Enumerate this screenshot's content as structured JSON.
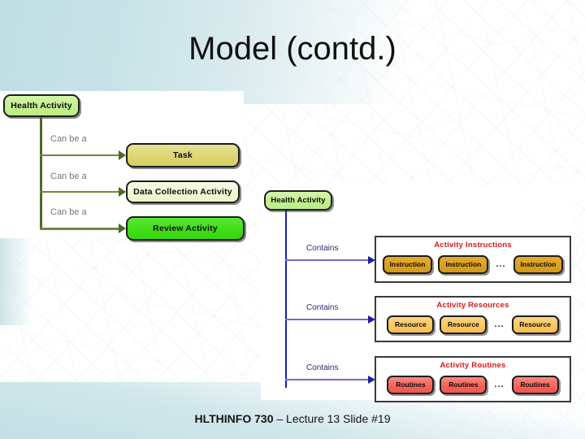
{
  "slide": {
    "title": "Model (contd.)",
    "footer_code": "HLTHINFO 730",
    "footer_rest": " – Lecture 13 Slide #19",
    "colors": {
      "background_tint": "#c3e0e5",
      "health_activity": "#c2ef8e",
      "task": "#dcd671",
      "data_collection_activity": "#eff7d2",
      "review_activity": "#3fdf16",
      "instruction": "#dca121",
      "resource": "#fbc85e",
      "routines": "#f4645c",
      "group_title": "#e01515",
      "left_connector": "#4d6b23",
      "right_connector": "#1e1ea8"
    }
  },
  "left_diagram": {
    "root": {
      "label": "Health Activity"
    },
    "edge_label": "Can be a",
    "branches": [
      {
        "edge_label": "Can be a",
        "target": "Task"
      },
      {
        "edge_label": "Can be a",
        "target": "Data Collection Activity"
      },
      {
        "edge_label": "Can be a",
        "target": "Review Activity"
      }
    ]
  },
  "right_diagram": {
    "root": {
      "label": "Health Activity"
    },
    "groups": [
      {
        "edge_label": "Contains",
        "title": "Activity Instructions",
        "items": [
          "Instruction",
          "Instruction",
          "Instruction"
        ],
        "ellipsis": "..."
      },
      {
        "edge_label": "Contains",
        "title": "Activity Resources",
        "items": [
          "Resource",
          "Resource",
          "Resource"
        ],
        "ellipsis": "..."
      },
      {
        "edge_label": "Contains",
        "title": "Activity Routines",
        "items": [
          "Routines",
          "Routines",
          "Routines"
        ],
        "ellipsis": "..."
      }
    ]
  }
}
